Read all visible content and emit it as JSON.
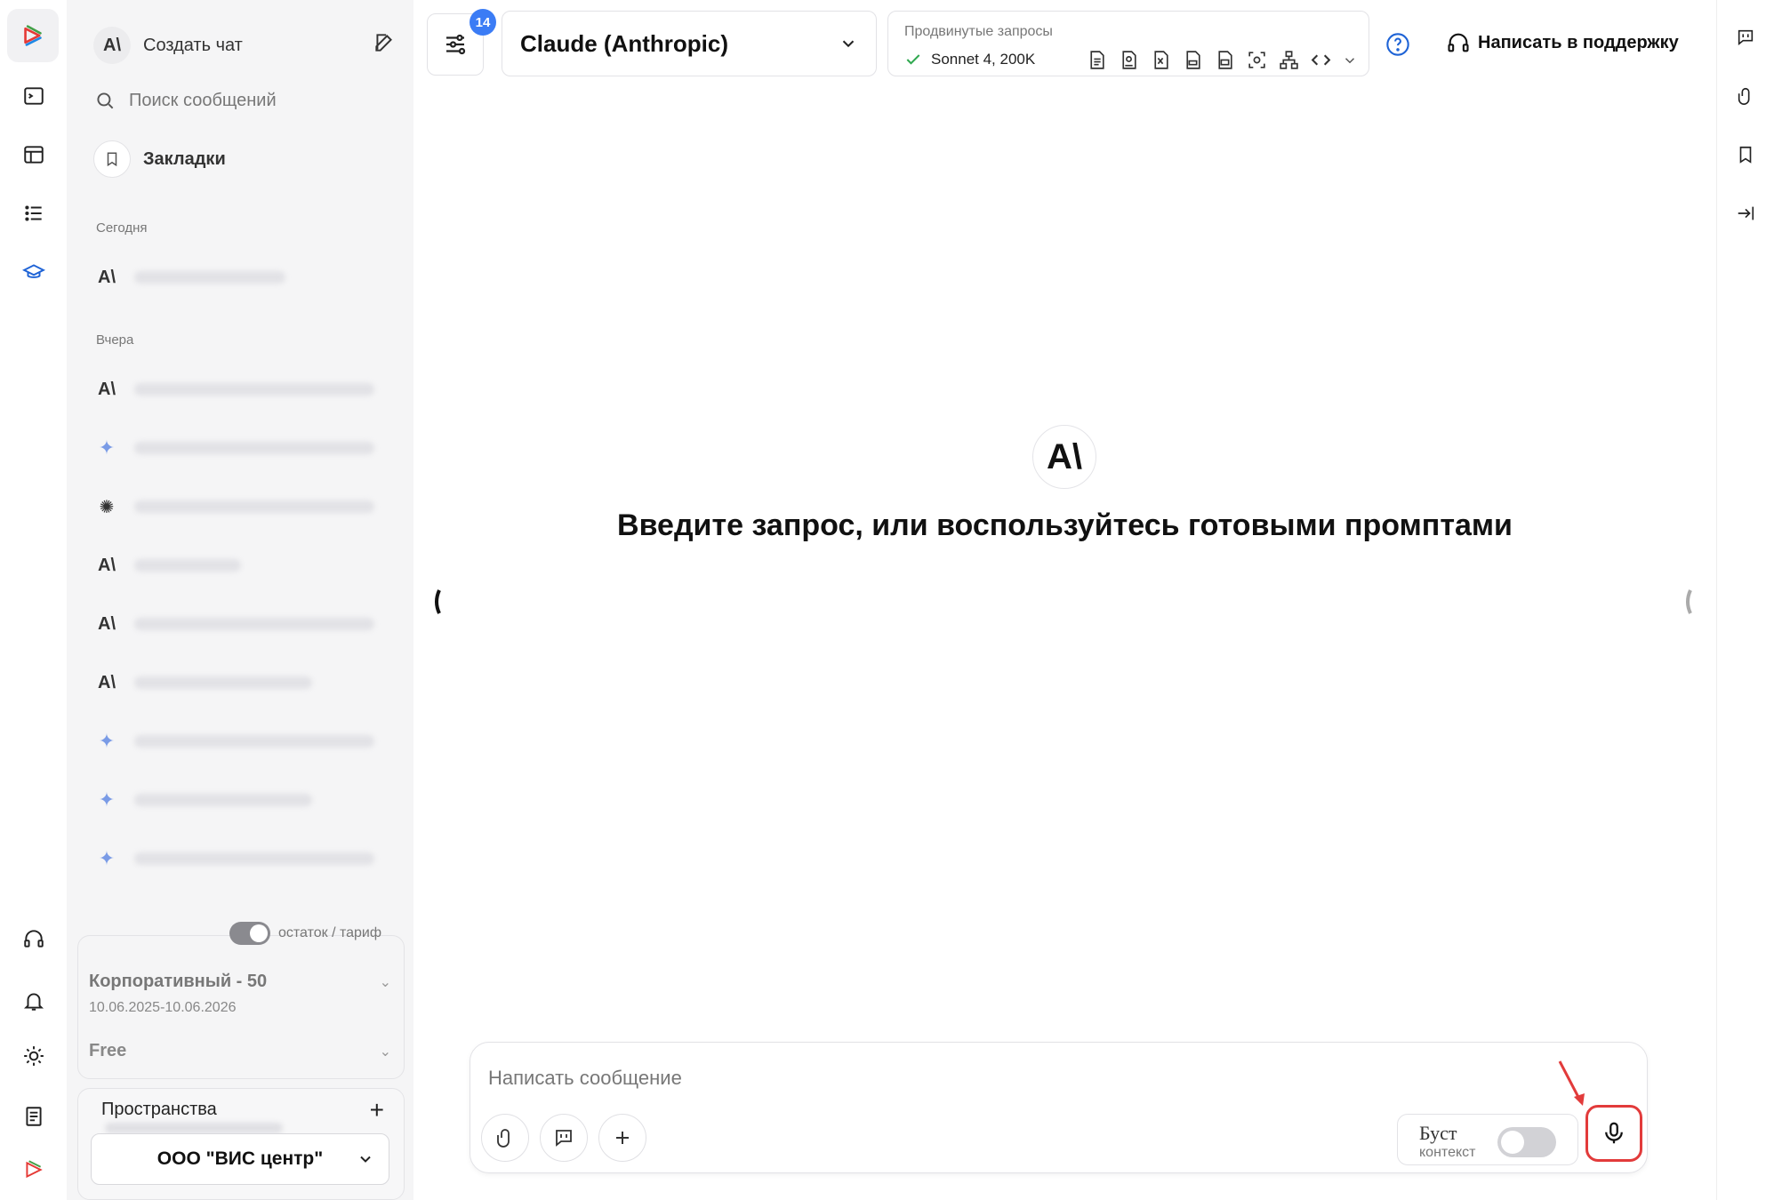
{
  "sidebar": {
    "new_chat": "Создать чат",
    "search_placeholder": "Поиск сообщений",
    "bookmarks": "Закладки",
    "section_today": "Сегодня",
    "section_yesterday": "Вчера",
    "balance_toggle_label": "остаток / тариф",
    "plan_name": "Корпоративный - 50",
    "plan_dates": "10.06.2025-10.06.2026",
    "plan_free": "Free",
    "spaces_title": "Пространства",
    "org_name": "ООО \"ВИС центр\""
  },
  "topbar": {
    "filter_badge": "14",
    "model_name": "Claude (Anthropic)",
    "advanced_title": "Продвинутые запросы",
    "advanced_value": "Sonnet 4, 200K",
    "support": "Написать в поддержку"
  },
  "main": {
    "logo_glyph": "A\\",
    "headline": "Введите запрос, или воспользуйтесь готовыми промптами"
  },
  "composer": {
    "placeholder": "Написать сообщение",
    "boost_label": "Буст",
    "boost_sub": "контекст"
  },
  "colors": {
    "accent": "#3b7cf5",
    "highlight": "#e23b3b",
    "sidebar_bg": "#f5f5f6"
  }
}
